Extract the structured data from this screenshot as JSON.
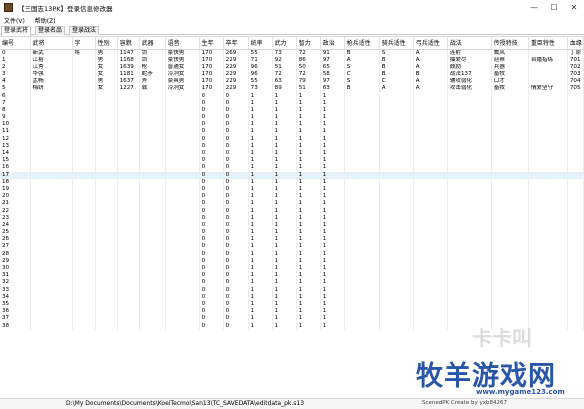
{
  "window": {
    "title": "【三国志13PK】登录信息修改器",
    "minimize": "—",
    "maximize": "☐",
    "close": "✕"
  },
  "menu": [
    "文件(V)",
    "帮助(Z)"
  ],
  "tabs": [
    "登录武将",
    "登录名品",
    "登录战法"
  ],
  "table": {
    "headers": [
      "编号",
      "武将",
      "字",
      "性别",
      "容貌",
      "武器",
      "语音",
      "生年",
      "卒年",
      "统率",
      "武力",
      "智力",
      "政治",
      "枪兵适性",
      "骑兵适性",
      "弓兵适性",
      "战法",
      "传授特技",
      "重臣特性",
      "血缘"
    ],
    "rows": [
      [
        "0",
        "新武",
        "将",
        "男",
        "1147",
        "剑",
        "豪快男",
        "170",
        "269",
        "55",
        "73",
        "72",
        "91",
        "B",
        "S",
        "A",
        "连射",
        "威风",
        "",
        "丁原"
      ],
      [
        "1",
        "江裕",
        "",
        "男",
        "1168",
        "剑",
        "豪快男",
        "170",
        "229",
        "71",
        "92",
        "86",
        "97",
        "A",
        "B",
        "A",
        "抽爱尽",
        "迎察",
        "台播指练",
        "701"
      ],
      [
        "2",
        "江秀",
        "",
        "女",
        "1639",
        "枪",
        "普通女",
        "170",
        "229",
        "96",
        "51",
        "50",
        "65",
        "S",
        "B",
        "A",
        "鼓励",
        "兵器",
        "",
        "702"
      ],
      [
        "3",
        "华强",
        "",
        "女",
        "1181",
        "蛇矛",
        "冷冽女",
        "170",
        "229",
        "96",
        "72",
        "72",
        "58",
        "C",
        "B",
        "B",
        "战法137",
        "畜牧",
        "",
        "703"
      ],
      [
        "4",
        "孟畅",
        "",
        "男",
        "1637",
        "斧",
        "豪爽男",
        "170",
        "229",
        "55",
        "63",
        "79",
        "97",
        "S",
        "C",
        "A",
        "辅攻弱化",
        "口才",
        "",
        "704"
      ],
      [
        "5",
        "梅妍",
        "",
        "女",
        "1227",
        "戟",
        "冷冽女",
        "170",
        "229",
        "73",
        "89",
        "51",
        "63",
        "B",
        "A",
        "A",
        "攻击弱化",
        "畜牧",
        "情爱坚守",
        "705"
      ],
      [
        "6",
        "",
        "",
        "",
        "",
        "",
        "",
        "0",
        "0",
        "1",
        "1",
        "1",
        "1",
        "",
        "",
        "",
        "",
        "",
        "",
        ""
      ],
      [
        "7",
        "",
        "",
        "",
        "",
        "",
        "",
        "0",
        "0",
        "1",
        "1",
        "1",
        "1",
        "",
        "",
        "",
        "",
        "",
        "",
        ""
      ],
      [
        "8",
        "",
        "",
        "",
        "",
        "",
        "",
        "0",
        "0",
        "1",
        "1",
        "1",
        "1",
        "",
        "",
        "",
        "",
        "",
        "",
        ""
      ],
      [
        "9",
        "",
        "",
        "",
        "",
        "",
        "",
        "0",
        "0",
        "1",
        "1",
        "1",
        "1",
        "",
        "",
        "",
        "",
        "",
        "",
        ""
      ],
      [
        "10",
        "",
        "",
        "",
        "",
        "",
        "",
        "0",
        "0",
        "1",
        "1",
        "1",
        "1",
        "",
        "",
        "",
        "",
        "",
        "",
        ""
      ],
      [
        "11",
        "",
        "",
        "",
        "",
        "",
        "",
        "0",
        "0",
        "1",
        "1",
        "1",
        "1",
        "",
        "",
        "",
        "",
        "",
        "",
        ""
      ],
      [
        "12",
        "",
        "",
        "",
        "",
        "",
        "",
        "0",
        "0",
        "1",
        "1",
        "1",
        "1",
        "",
        "",
        "",
        "",
        "",
        "",
        ""
      ],
      [
        "13",
        "",
        "",
        "",
        "",
        "",
        "",
        "0",
        "0",
        "1",
        "1",
        "1",
        "1",
        "",
        "",
        "",
        "",
        "",
        "",
        ""
      ],
      [
        "14",
        "",
        "",
        "",
        "",
        "",
        "",
        "0",
        "0",
        "1",
        "1",
        "1",
        "1",
        "",
        "",
        "",
        "",
        "",
        "",
        ""
      ],
      [
        "15",
        "",
        "",
        "",
        "",
        "",
        "",
        "0",
        "0",
        "1",
        "1",
        "1",
        "1",
        "",
        "",
        "",
        "",
        "",
        "",
        ""
      ],
      [
        "16",
        "",
        "",
        "",
        "",
        "",
        "",
        "0",
        "0",
        "1",
        "1",
        "1",
        "1",
        "",
        "",
        "",
        "",
        "",
        "",
        ""
      ],
      [
        "17",
        "",
        "",
        "",
        "",
        "",
        "",
        "0",
        "0",
        "1",
        "1",
        "1",
        "1",
        "",
        "",
        "",
        "",
        "",
        "",
        ""
      ],
      [
        "18",
        "",
        "",
        "",
        "",
        "",
        "",
        "0",
        "0",
        "1",
        "1",
        "1",
        "1",
        "",
        "",
        "",
        "",
        "",
        "",
        ""
      ],
      [
        "19",
        "",
        "",
        "",
        "",
        "",
        "",
        "0",
        "0",
        "1",
        "1",
        "1",
        "1",
        "",
        "",
        "",
        "",
        "",
        "",
        ""
      ],
      [
        "20",
        "",
        "",
        "",
        "",
        "",
        "",
        "0",
        "0",
        "1",
        "1",
        "1",
        "1",
        "",
        "",
        "",
        "",
        "",
        "",
        ""
      ],
      [
        "21",
        "",
        "",
        "",
        "",
        "",
        "",
        "0",
        "0",
        "1",
        "1",
        "1",
        "1",
        "",
        "",
        "",
        "",
        "",
        "",
        ""
      ],
      [
        "22",
        "",
        "",
        "",
        "",
        "",
        "",
        "0",
        "0",
        "1",
        "1",
        "1",
        "1",
        "",
        "",
        "",
        "",
        "",
        "",
        ""
      ],
      [
        "23",
        "",
        "",
        "",
        "",
        "",
        "",
        "0",
        "0",
        "1",
        "1",
        "1",
        "1",
        "",
        "",
        "",
        "",
        "",
        "",
        ""
      ],
      [
        "24",
        "",
        "",
        "",
        "",
        "",
        "",
        "0",
        "0",
        "1",
        "1",
        "1",
        "1",
        "",
        "",
        "",
        "",
        "",
        "",
        ""
      ],
      [
        "25",
        "",
        "",
        "",
        "",
        "",
        "",
        "0",
        "0",
        "1",
        "1",
        "1",
        "1",
        "",
        "",
        "",
        "",
        "",
        "",
        ""
      ],
      [
        "26",
        "",
        "",
        "",
        "",
        "",
        "",
        "0",
        "0",
        "1",
        "1",
        "1",
        "1",
        "",
        "",
        "",
        "",
        "",
        "",
        ""
      ],
      [
        "27",
        "",
        "",
        "",
        "",
        "",
        "",
        "0",
        "0",
        "1",
        "1",
        "1",
        "1",
        "",
        "",
        "",
        "",
        "",
        "",
        ""
      ],
      [
        "28",
        "",
        "",
        "",
        "",
        "",
        "",
        "0",
        "0",
        "1",
        "1",
        "1",
        "1",
        "",
        "",
        "",
        "",
        "",
        "",
        ""
      ],
      [
        "29",
        "",
        "",
        "",
        "",
        "",
        "",
        "0",
        "0",
        "1",
        "1",
        "1",
        "1",
        "",
        "",
        "",
        "",
        "",
        "",
        ""
      ],
      [
        "30",
        "",
        "",
        "",
        "",
        "",
        "",
        "0",
        "0",
        "1",
        "1",
        "1",
        "1",
        "",
        "",
        "",
        "",
        "",
        "",
        ""
      ],
      [
        "31",
        "",
        "",
        "",
        "",
        "",
        "",
        "0",
        "0",
        "1",
        "1",
        "1",
        "1",
        "",
        "",
        "",
        "",
        "",
        "",
        ""
      ],
      [
        "32",
        "",
        "",
        "",
        "",
        "",
        "",
        "0",
        "0",
        "1",
        "1",
        "1",
        "1",
        "",
        "",
        "",
        "",
        "",
        "",
        ""
      ],
      [
        "33",
        "",
        "",
        "",
        "",
        "",
        "",
        "0",
        "0",
        "1",
        "1",
        "1",
        "1",
        "",
        "",
        "",
        "",
        "",
        "",
        ""
      ],
      [
        "34",
        "",
        "",
        "",
        "",
        "",
        "",
        "0",
        "0",
        "1",
        "1",
        "1",
        "1",
        "",
        "",
        "",
        "",
        "",
        "",
        ""
      ],
      [
        "35",
        "",
        "",
        "",
        "",
        "",
        "",
        "0",
        "0",
        "1",
        "1",
        "1",
        "1",
        "",
        "",
        "",
        "",
        "",
        "",
        ""
      ],
      [
        "36",
        "",
        "",
        "",
        "",
        "",
        "",
        "0",
        "0",
        "1",
        "1",
        "1",
        "1",
        "",
        "",
        "",
        "",
        "",
        "",
        ""
      ],
      [
        "37",
        "",
        "",
        "",
        "",
        "",
        "",
        "0",
        "0",
        "1",
        "1",
        "1",
        "1",
        "",
        "",
        "",
        "",
        "",
        "",
        ""
      ],
      [
        "38",
        "",
        "",
        "",
        "",
        "",
        "",
        "0",
        "0",
        "1",
        "1",
        "1",
        "1",
        "",
        "",
        "",
        "",
        "",
        "",
        ""
      ]
    ],
    "selected_row": "17"
  },
  "status": {
    "path": "D:\\My Documents\\Documents\\KoeiTecmo\\San13\\TC_SAVEDATA\\editdata_pk.s13",
    "credit": "ScenedPK Create by yxb84267"
  },
  "watermark": {
    "main": "牧羊游戏网",
    "faded": "卡卡叫",
    "url": "www.mygame123.com"
  },
  "colors": {
    "selection": "#e5f1fb",
    "watermark": "#2a56a8"
  }
}
